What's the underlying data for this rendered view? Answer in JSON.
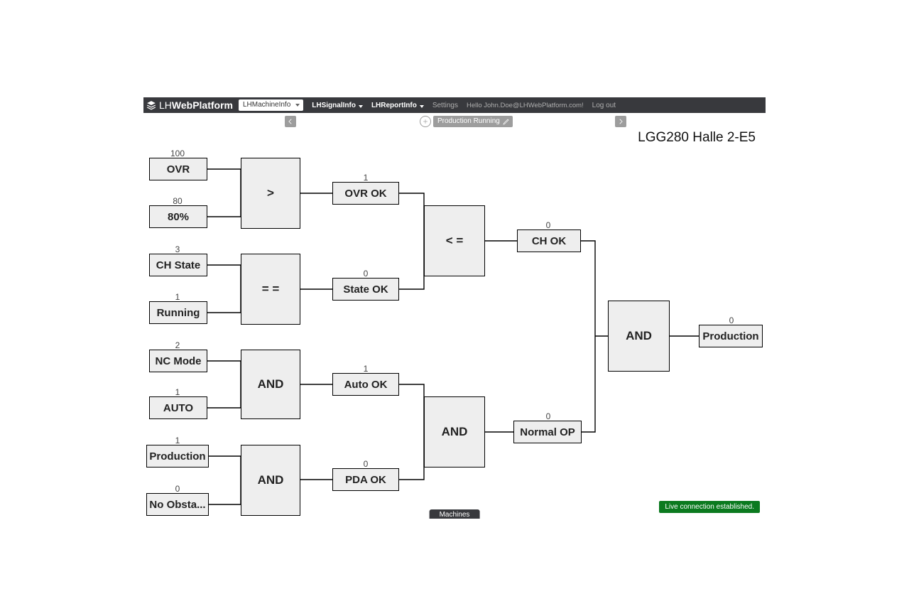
{
  "brand": {
    "prefix": "LH",
    "suffix": "WebPlatform"
  },
  "nav": {
    "select": "LHMachineInfo",
    "items": [
      "LHSignalInfo",
      "LHReportInfo"
    ],
    "settings": "Settings",
    "greeting": "Hello John.Doe@LHWebPlatform.com!",
    "logout": "Log out"
  },
  "subbar": {
    "chip": "Production Running"
  },
  "page_title": "LGG280 Halle 2-E5",
  "nodes": {
    "ovr": {
      "label": "OVR",
      "value": "100"
    },
    "pct80": {
      "label": "80%",
      "value": "80"
    },
    "gt": {
      "label": ">"
    },
    "ovrok": {
      "label": "OVR OK",
      "value": "1"
    },
    "chstate": {
      "label": "CH State",
      "value": "3"
    },
    "running": {
      "label": "Running",
      "value": "1"
    },
    "eq": {
      "label": "= ="
    },
    "stateok": {
      "label": "State OK",
      "value": "0"
    },
    "lte": {
      "label": "< ="
    },
    "chok": {
      "label": "CH OK",
      "value": "0"
    },
    "ncmode": {
      "label": "NC Mode",
      "value": "2"
    },
    "auto": {
      "label": "AUTO",
      "value": "1"
    },
    "and1": {
      "label": "AND"
    },
    "autook": {
      "label": "Auto OK",
      "value": "1"
    },
    "prodin": {
      "label": "Production",
      "value": "1"
    },
    "noobsta": {
      "label": "No Obsta...",
      "value": "0"
    },
    "and2": {
      "label": "AND"
    },
    "pdaok": {
      "label": "PDA OK",
      "value": "0"
    },
    "and3": {
      "label": "AND"
    },
    "normalop": {
      "label": "Normal OP",
      "value": "0"
    },
    "andfinal": {
      "label": "AND"
    },
    "production": {
      "label": "Production",
      "value": "0"
    }
  },
  "bottom": {
    "tab": "Machines",
    "status": "Live connection established."
  }
}
